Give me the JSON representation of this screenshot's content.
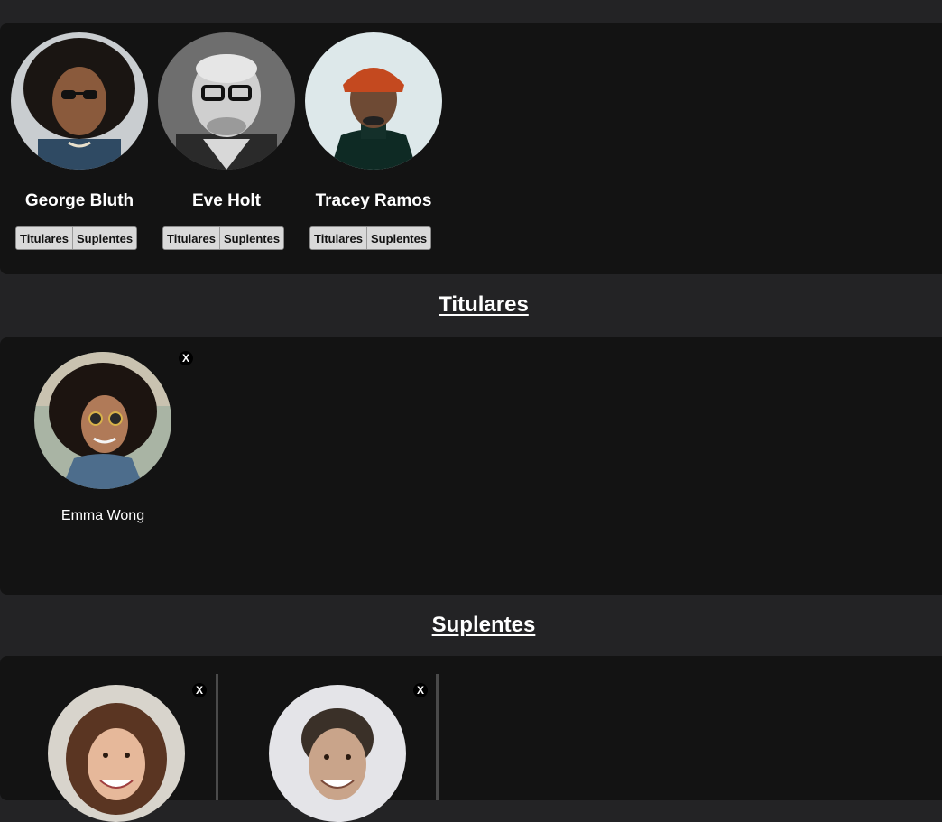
{
  "players": [
    {
      "name": "George Bluth",
      "btn_titulares": "Titulares",
      "btn_suplentes": "Suplentes"
    },
    {
      "name": "Eve Holt",
      "btn_titulares": "Titulares",
      "btn_suplentes": "Suplentes"
    },
    {
      "name": "Tracey Ramos",
      "btn_titulares": "Titulares",
      "btn_suplentes": "Suplentes"
    }
  ],
  "titulares": {
    "title": "Titulares",
    "members": [
      {
        "name": "Emma Wong",
        "remove_label": "X"
      }
    ]
  },
  "suplentes": {
    "title": "Suplentes",
    "members": [
      {
        "remove_label": "X"
      },
      {
        "remove_label": "X"
      }
    ]
  },
  "colors": {
    "page_bg": "#232325",
    "panel_bg": "#131313",
    "button_bg": "#d9d9d9",
    "text": "#ffffff"
  }
}
